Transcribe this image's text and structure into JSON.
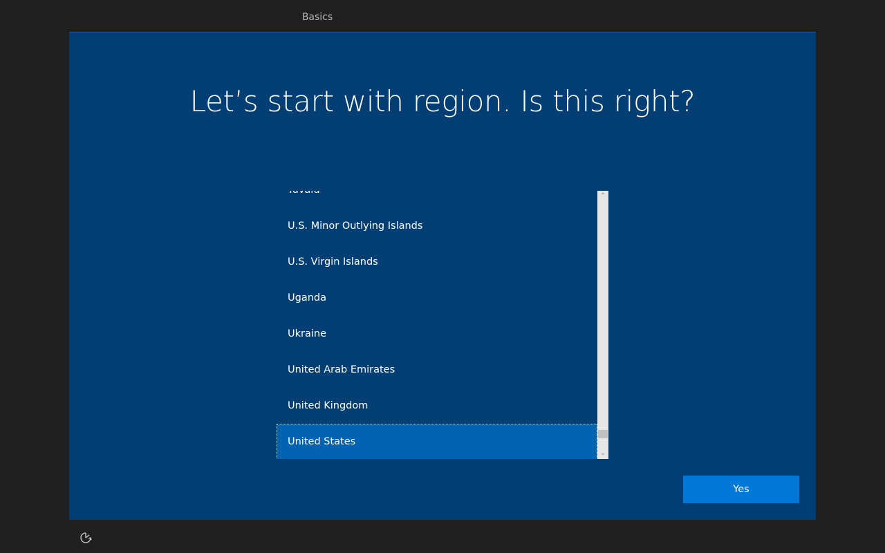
{
  "header": {
    "tab_label": "Basics"
  },
  "main": {
    "title": "Let’s start with region. Is this right?",
    "regions": [
      "Tuvalu",
      "U.S. Minor Outlying Islands",
      "U.S. Virgin Islands",
      "Uganda",
      "Ukraine",
      "United Arab Emirates",
      "United Kingdom",
      "United States"
    ],
    "selected_region": "United States",
    "yes_label": "Yes"
  },
  "footer": {
    "accessibility_icon": "ease-of-access-icon"
  },
  "colors": {
    "panel_bg": "#003e73",
    "selected_bg": "#0063b1",
    "button_bg": "#0078d7",
    "outer_bg": "#202020"
  }
}
